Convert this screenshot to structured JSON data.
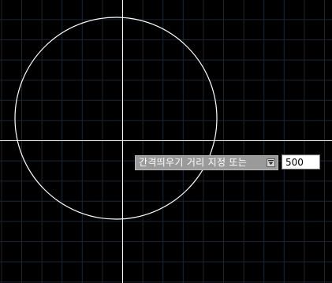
{
  "viewport": {
    "background_color": "#000000",
    "grid_color": "#1c2530",
    "crosshair_color": "#ffffff",
    "geometry_color": "#ffffff"
  },
  "drawing": {
    "objects": [
      {
        "type": "circle",
        "name": "circle-object"
      }
    ]
  },
  "dynamic_input": {
    "prompt": "간격띄우기 거리 지정 또는",
    "options_icon": "down-arrow-options-icon",
    "value": "500"
  }
}
